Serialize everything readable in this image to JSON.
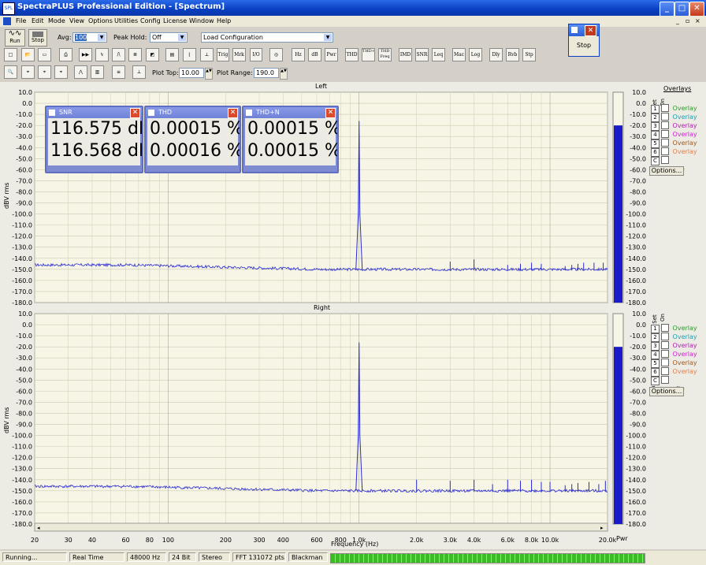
{
  "window": {
    "title": "SpectraPLUS Professional Edition - [Spectrum]"
  },
  "menu": [
    "File",
    "Edit",
    "Mode",
    "View",
    "Options",
    "Utilities",
    "Config",
    "License",
    "Window",
    "Help"
  ],
  "toolbar": {
    "run_label": "Run",
    "stop_label": "Stop",
    "avg_label": "Avg:",
    "avg_value": "100",
    "peak_label": "Peak Hold:",
    "peak_value": "Off",
    "config_value": "Load Configuration",
    "plot_top_label": "Plot Top:",
    "plot_top_value": "10.00",
    "plot_range_label": "Plot Range:",
    "plot_range_value": "190.0",
    "tools": [
      "Trig",
      "Mrk",
      "I/O",
      "Hz",
      "dB",
      "Pwr",
      "THD",
      "THD+N",
      "THD Freq",
      "IMD",
      "SNR",
      "Leq",
      "Mac",
      "Log",
      "Dly",
      "Rvb",
      "Stp"
    ]
  },
  "stop_dialog": {
    "button_label": "Stop"
  },
  "meters": [
    {
      "title": "SNR",
      "value1": "116.575 dB",
      "value2": "116.568 dB"
    },
    {
      "title": "THD",
      "value1": "0.00015 %",
      "value2": "0.00016 %"
    },
    {
      "title": "THD+N",
      "value1": "0.00015 %",
      "value2": "0.00015 %"
    }
  ],
  "plots": [
    {
      "title": "Left",
      "ylabel": "dBV rms"
    },
    {
      "title": "Right",
      "ylabel": "dBV rms"
    }
  ],
  "xlabel": "Frequency (Hz)",
  "pwr_label": "Pwr",
  "y_ticks": [
    "10.0",
    "0.0",
    "-10.0",
    "-20.0",
    "-30.0",
    "-40.0",
    "-50.0",
    "-60.0",
    "-70.0",
    "-80.0",
    "-90.0",
    "-100.0",
    "-110.0",
    "-120.0",
    "-130.0",
    "-140.0",
    "-150.0",
    "-160.0",
    "-170.0",
    "-180.0"
  ],
  "x_ticks": [
    "20",
    "30",
    "40",
    "60",
    "80",
    "100",
    "200",
    "300",
    "400",
    "600",
    "800",
    "1.0k",
    "2.0k",
    "3.0k",
    "4.0k",
    "6.0k",
    "8.0k",
    "10.0k",
    "20.0k"
  ],
  "x_tick_freqs": [
    20,
    30,
    40,
    60,
    80,
    100,
    200,
    300,
    400,
    600,
    800,
    1000,
    2000,
    3000,
    4000,
    6000,
    8000,
    10000,
    20000
  ],
  "overlays": {
    "title": "Overlays",
    "set_label": "Set",
    "on_label": "On",
    "items": [
      {
        "num": "1",
        "label": "Overlay 1",
        "color": "#2a9a2a"
      },
      {
        "num": "2",
        "label": "Overlay 2",
        "color": "#20a0b0"
      },
      {
        "num": "3",
        "label": "Overlay 3",
        "color": "#b020b0"
      },
      {
        "num": "4",
        "label": "Overlay 4",
        "color": "#d020d0"
      },
      {
        "num": "5",
        "label": "Overlay 5",
        "color": "#9a5a20"
      },
      {
        "num": "6",
        "label": "Overlay 6",
        "color": "#e08050"
      },
      {
        "num": "C",
        "label": "Composite",
        "color": "#000000"
      }
    ],
    "options_label": "Options..."
  },
  "status": [
    "Running...",
    "Real Time",
    "48000 Hz",
    "24 Bit",
    "Stereo",
    "FFT 131072 pts",
    "Blackman"
  ],
  "chart_data": [
    {
      "type": "line",
      "title": "Left",
      "ylabel": "dBV rms",
      "xlabel": "Frequency (Hz)",
      "xscale": "log",
      "xlim": [
        20,
        20000
      ],
      "ylim": [
        -180,
        10
      ],
      "series": [
        {
          "color": "#2222cc",
          "points": [
            [
              20,
              -144
            ],
            [
              100,
              -149
            ],
            [
              500,
              -150
            ],
            [
              950,
              -150
            ],
            [
              1000,
              -16
            ],
            [
              1050,
              -150
            ],
            [
              2000,
              -151
            ],
            [
              3000,
              -143
            ],
            [
              4000,
              -141
            ],
            [
              5000,
              -150
            ],
            [
              6000,
              -146
            ],
            [
              8000,
              -145
            ],
            [
              10000,
              -144
            ],
            [
              15000,
              -144
            ],
            [
              20000,
              -145
            ]
          ]
        }
      ]
    },
    {
      "type": "line",
      "title": "Right",
      "ylabel": "dBV rms",
      "xlabel": "Frequency (Hz)",
      "xscale": "log",
      "xlim": [
        20,
        20000
      ],
      "ylim": [
        -180,
        10
      ],
      "series": [
        {
          "color": "#2222cc",
          "points": [
            [
              20,
              -145
            ],
            [
              100,
              -149
            ],
            [
              500,
              -150
            ],
            [
              950,
              -150
            ],
            [
              1000,
              -16
            ],
            [
              1050,
              -150
            ],
            [
              2000,
              -140
            ],
            [
              3000,
              -141
            ],
            [
              4000,
              -140
            ],
            [
              5000,
              -144
            ],
            [
              6000,
              -140
            ],
            [
              8000,
              -140
            ],
            [
              10000,
              -142
            ],
            [
              15000,
              -139
            ],
            [
              20000,
              -144
            ]
          ]
        }
      ]
    }
  ]
}
